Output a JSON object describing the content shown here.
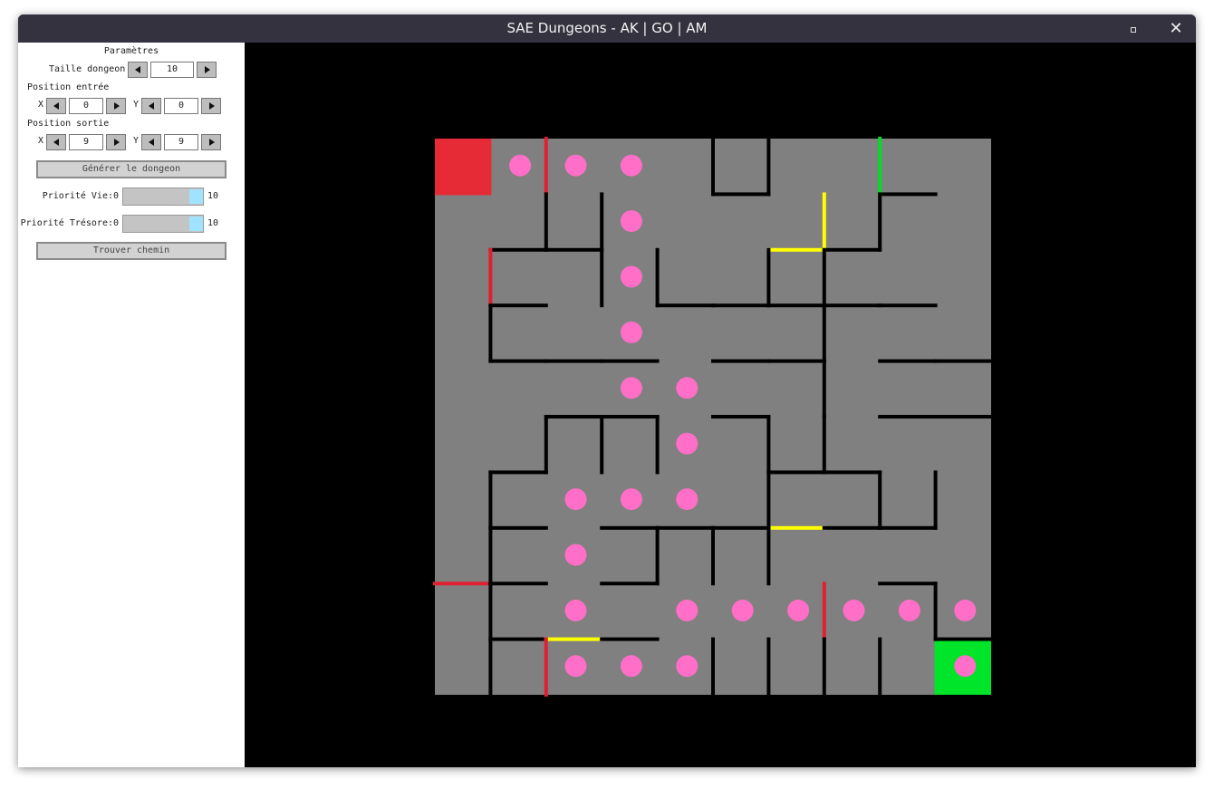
{
  "window": {
    "title": "SAE Dungeons - AK | GO | AM",
    "close_symbol": "✕"
  },
  "params": {
    "header": "Paramètres",
    "size_label": "Taille dongeon",
    "size_value": "10",
    "entry_label": "Position entrée",
    "exit_label": "Position sortie",
    "x_label": "X",
    "y_label": "Y",
    "entry": {
      "x": "0",
      "y": "0"
    },
    "exit": {
      "x": "9",
      "y": "9"
    },
    "generate_button": "Générer le dongeon",
    "life_label": "Priorité Vie:",
    "treasure_label": "Priorité Trésore:",
    "slider_min": "0",
    "slider_max": "10",
    "life_priority": 10,
    "treasure_priority": 10,
    "path_button": "Trouver chemin"
  },
  "dungeon": {
    "size": 10,
    "colors": {
      "floor": "#808080",
      "wall": "#000000",
      "entry": "#e62a36",
      "exit": "#00e42a",
      "path": "#ff6ec7",
      "monster": "#e02030",
      "treasure": "#ffff00",
      "life": "#00dd22"
    },
    "entry_cell": [
      0,
      0
    ],
    "exit_cell": [
      9,
      9
    ],
    "path": [
      [
        0,
        1
      ],
      [
        0,
        2
      ],
      [
        0,
        3
      ],
      [
        1,
        3
      ],
      [
        2,
        3
      ],
      [
        3,
        3
      ],
      [
        4,
        3
      ],
      [
        4,
        4
      ],
      [
        5,
        4
      ],
      [
        6,
        4
      ],
      [
        6,
        3
      ],
      [
        6,
        2
      ],
      [
        7,
        2
      ],
      [
        8,
        2
      ],
      [
        8,
        4
      ],
      [
        8,
        5
      ],
      [
        8,
        6
      ],
      [
        8,
        7
      ],
      [
        8,
        8
      ],
      [
        9,
        2
      ],
      [
        9,
        3
      ],
      [
        9,
        4
      ],
      [
        8,
        9
      ],
      [
        9,
        9
      ]
    ],
    "h_walls": [
      [
        0,
        0,
        0,
        0,
        0,
        1,
        0,
        0,
        1,
        0
      ],
      [
        0,
        1,
        1,
        0,
        0,
        0,
        0,
        1,
        0,
        0
      ],
      [
        0,
        1,
        0,
        0,
        1,
        1,
        1,
        1,
        1,
        0
      ],
      [
        0,
        1,
        1,
        1,
        0,
        1,
        1,
        0,
        1,
        1
      ],
      [
        0,
        0,
        1,
        1,
        0,
        1,
        0,
        0,
        1,
        1
      ],
      [
        0,
        1,
        0,
        0,
        0,
        0,
        1,
        1,
        0,
        0
      ],
      [
        0,
        1,
        0,
        1,
        1,
        1,
        1,
        1,
        1,
        0
      ],
      [
        1,
        1,
        0,
        1,
        0,
        0,
        0,
        0,
        1,
        0
      ],
      [
        0,
        1,
        1,
        1,
        0,
        0,
        0,
        0,
        0,
        1
      ]
    ],
    "h_specials": [
      {
        "row": 1,
        "col": 6,
        "kind": "treasure"
      },
      {
        "row": 6,
        "col": 6,
        "kind": "treasure"
      },
      {
        "row": 7,
        "col": 0,
        "kind": "monster"
      },
      {
        "row": 8,
        "col": 2,
        "kind": "treasure"
      }
    ],
    "v_walls": [
      [
        0,
        1,
        0,
        0,
        1,
        1,
        0,
        1,
        0
      ],
      [
        0,
        1,
        1,
        0,
        0,
        0,
        1,
        1,
        0
      ],
      [
        0,
        0,
        1,
        1,
        0,
        1,
        1,
        0,
        0
      ],
      [
        1,
        0,
        0,
        0,
        0,
        0,
        1,
        0,
        0
      ],
      [
        0,
        0,
        0,
        0,
        0,
        0,
        1,
        0,
        0
      ],
      [
        0,
        1,
        1,
        1,
        0,
        1,
        1,
        0,
        0
      ],
      [
        1,
        0,
        0,
        0,
        0,
        1,
        0,
        1,
        1
      ],
      [
        1,
        0,
        0,
        1,
        1,
        1,
        0,
        0,
        0
      ],
      [
        1,
        0,
        0,
        0,
        0,
        0,
        1,
        0,
        1
      ],
      [
        1,
        1,
        0,
        0,
        1,
        1,
        1,
        1,
        0
      ]
    ],
    "v_specials": [
      {
        "row": 0,
        "col": 1,
        "kind": "monster"
      },
      {
        "row": 0,
        "col": 7,
        "kind": "life"
      },
      {
        "row": 1,
        "col": 6,
        "kind": "treasure"
      },
      {
        "row": 2,
        "col": 0,
        "kind": "monster"
      },
      {
        "row": 8,
        "col": 6,
        "kind": "monster"
      },
      {
        "row": 9,
        "col": 1,
        "kind": "monster"
      }
    ]
  }
}
